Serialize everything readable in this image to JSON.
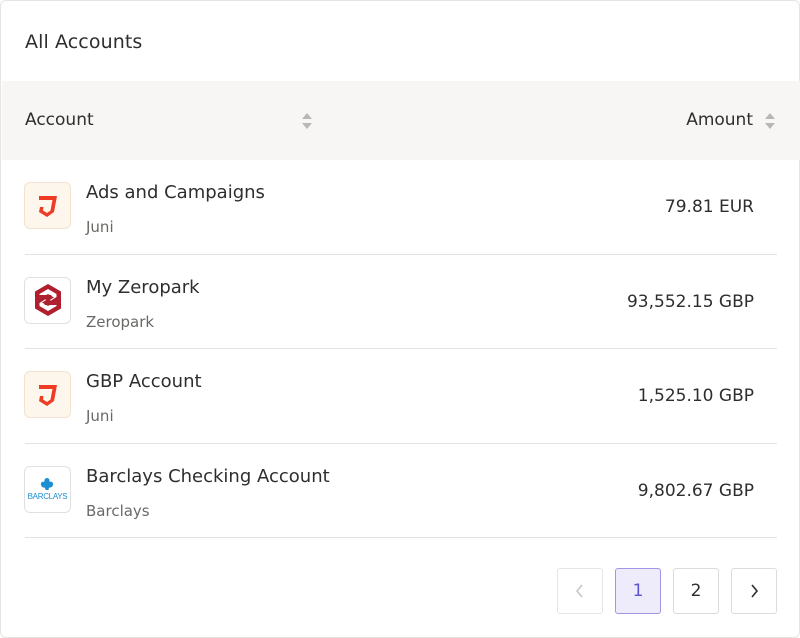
{
  "card": {
    "title": "All Accounts"
  },
  "table": {
    "columns": {
      "account": "Account",
      "amount": "Amount"
    },
    "rows": [
      {
        "name": "Ads and Campaigns",
        "provider": "Juni",
        "amount": "79.81 EUR",
        "logo": "juni-logo"
      },
      {
        "name": "My Zeropark",
        "provider": "Zeropark",
        "amount": "93,552.15 GBP",
        "logo": "zeropark-logo"
      },
      {
        "name": "GBP Account",
        "provider": "Juni",
        "amount": "1,525.10 GBP",
        "logo": "juni-logo"
      },
      {
        "name": "Barclays Checking Account",
        "provider": "Barclays",
        "amount": "9,802.67 GBP",
        "logo": "barclays-logo",
        "logo_text": "BARCLAYS"
      }
    ]
  },
  "pagination": {
    "prev_icon": "‹",
    "pages": [
      "1",
      "2"
    ],
    "current_page": "1",
    "next_icon": "›"
  },
  "colors": {
    "juni_red": "#ee3b24",
    "zeropark_red": "#b01f2e",
    "barclays_blue": "#1a8fd3",
    "active_page": "#5b52d6"
  }
}
